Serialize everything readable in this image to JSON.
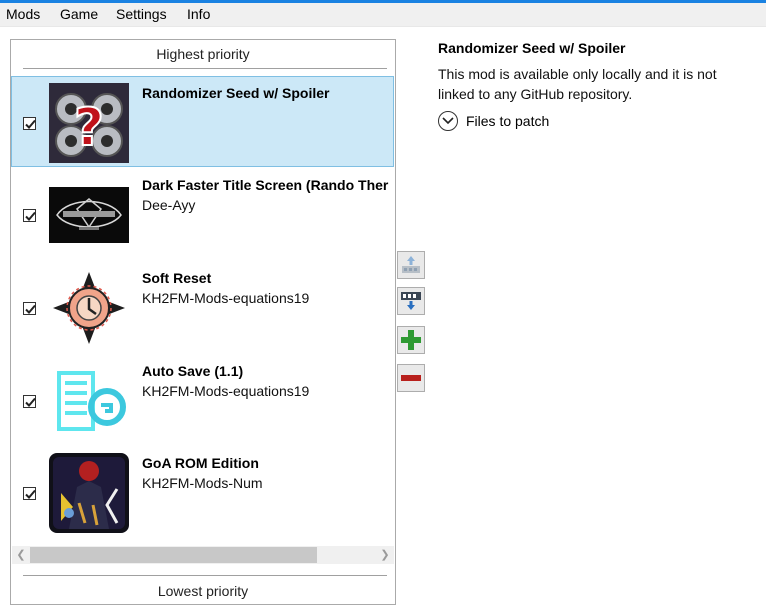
{
  "menu": [
    "Mods",
    "Game",
    "Settings",
    "Info"
  ],
  "panel": {
    "highest_label": "Highest priority",
    "lowest_label": "Lowest priority"
  },
  "mods": [
    {
      "title": "Randomizer Seed w/ Spoiler",
      "author": "",
      "checked": true,
      "selected": true,
      "icon": "randomizer-icon"
    },
    {
      "title": "Dark Faster Title Screen (Rando Ther",
      "author": "Dee-Ayy",
      "checked": true,
      "selected": false,
      "icon": "kingdom-hearts-logo-icon"
    },
    {
      "title": "Soft Reset",
      "author": "KH2FM-Mods-equations19",
      "checked": true,
      "selected": false,
      "icon": "soft-reset-icon"
    },
    {
      "title": "Auto Save (1.1)",
      "author": "KH2FM-Mods-equations19",
      "checked": true,
      "selected": false,
      "icon": "auto-save-icon"
    },
    {
      "title": "GoA ROM Edition",
      "author": "KH2FM-Mods-Num",
      "checked": true,
      "selected": false,
      "icon": "goa-rom-icon"
    }
  ],
  "toolbar": [
    "move-up-icon",
    "move-down-icon",
    "add-icon",
    "remove-icon"
  ],
  "details": {
    "title": "Randomizer Seed w/ Spoiler",
    "description": "This mod is available only locally and it is not linked to any GitHub repository.",
    "files_label": "Files to patch"
  }
}
